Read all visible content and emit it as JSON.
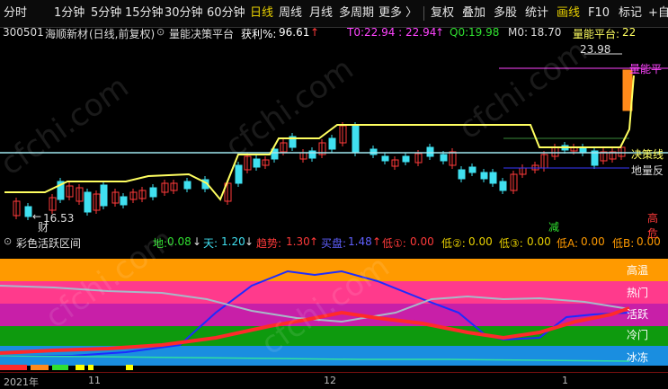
{
  "toolbar": {
    "items": [
      "分时",
      "1分钟",
      "5分钟",
      "15分钟",
      "30分钟",
      "60分钟",
      "日线",
      "周线",
      "月线",
      "多周期",
      "更多 〉",
      "复权",
      "叠加",
      "多股",
      "统计",
      "画线",
      "F10",
      "标记",
      "+自"
    ],
    "selected": [
      "日线",
      "画线"
    ]
  },
  "info": {
    "code": "300501",
    "name": "海顺新材",
    "period": "(日线,前复权)",
    "indicator": "量能决策平台",
    "profit_label": "获利%:",
    "profit_value": "96.61",
    "t0_label": "T0:",
    "t0_value": "22.94 : 22.94",
    "q0_label": "Q0:",
    "q0_value": "19.98",
    "m0_label": "M0:",
    "m0_value": "18.70",
    "platform_label": "量能平台:",
    "platform_value": "22"
  },
  "main_chart": {
    "high_price": "23.98",
    "low_price": "16.53",
    "label_platform": "量能平",
    "label_decision": "决策线",
    "label_low": "地量反",
    "label_gaowei": "高危",
    "marker_cai": "财",
    "marker_jian": "减"
  },
  "indicator_header": {
    "title": "彩色活跃区间",
    "di_label": "地:",
    "di_value": "0.08",
    "tian_label": "天:",
    "tian_value": "1.20",
    "trend_label": "趋势:",
    "trend_value": "1.30",
    "buy_label": "买盘:",
    "buy_value": "1.48",
    "low1_label": "低①:",
    "low1_value": "0.00",
    "low2_label": "低②:",
    "low2_value": "0.00",
    "low3_label": "低③:",
    "low3_value": "0.00",
    "lowA_label": "低A:",
    "lowA_value": "0.00",
    "lowB_label": "低B:",
    "lowB_value": "0.00"
  },
  "bands": [
    "高温",
    "热门",
    "活跃",
    "冷门",
    "冰冻"
  ],
  "time_axis": [
    "2021年",
    "11",
    "12",
    "1"
  ],
  "watermark": "cfchi.com",
  "colors": {
    "band_high": "#ff9a00",
    "band_hot": "#ff3a8c",
    "band_active": "#c81fa8",
    "band_cold": "#0e9a0e",
    "band_frozen": "#1a8ee0",
    "up": "#ff3a3a",
    "down": "#40e0f0",
    "decision_line": "#ffff60"
  }
}
